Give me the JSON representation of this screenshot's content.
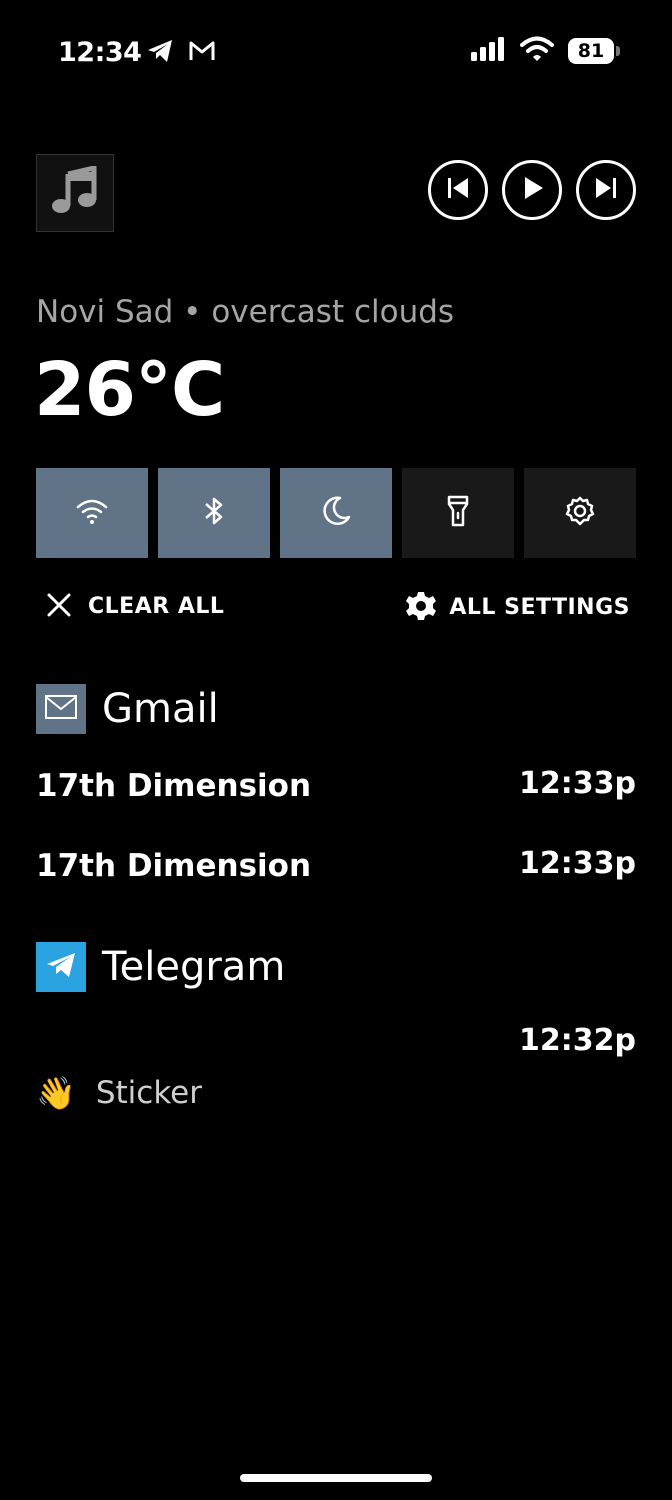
{
  "status_bar": {
    "time": "12:34",
    "battery": "81",
    "icons": [
      "telegram-icon",
      "gmail-icon",
      "signal-icon",
      "wifi-icon",
      "battery-icon"
    ]
  },
  "media": {
    "art_icon": "music-note-icon",
    "controls": [
      "previous-icon",
      "play-icon",
      "next-icon"
    ]
  },
  "weather": {
    "summary": "Novi Sad • overcast clouds",
    "temperature": "26°C"
  },
  "toggles": [
    {
      "icon": "wifi-icon",
      "state": "on"
    },
    {
      "icon": "bluetooth-icon",
      "state": "on"
    },
    {
      "icon": "moon-icon",
      "state": "on"
    },
    {
      "icon": "flashlight-icon",
      "state": "off"
    },
    {
      "icon": "gear-icon",
      "state": "off"
    }
  ],
  "actions": {
    "clear_all": "CLEAR ALL",
    "all_settings": "ALL SETTINGS"
  },
  "notifications": {
    "gmail": {
      "app": "Gmail",
      "items": [
        {
          "title": "17th Dimension",
          "time": "12:33p"
        },
        {
          "title": "17th Dimension",
          "time": "12:33p"
        }
      ]
    },
    "telegram": {
      "app": "Telegram",
      "time": "12:32p",
      "sticker_emoji": "👋",
      "sticker_label": "Sticker"
    }
  },
  "colors": {
    "toggle_on": "#617386",
    "toggle_off": "#191919",
    "gmail_icon_bg": "#617386",
    "telegram_icon_bg": "#2aa3e0",
    "secondary_text": "#a5a5a5"
  }
}
